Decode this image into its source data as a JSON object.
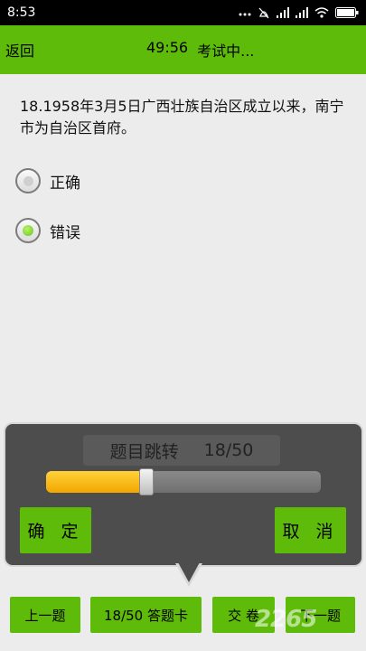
{
  "status_bar": {
    "time": "8:53",
    "icons": [
      "dots-icon",
      "alarm-off-icon",
      "signal-icon",
      "signal-icon",
      "wifi-icon",
      "battery-icon"
    ]
  },
  "header": {
    "back_label": "返回",
    "timer": "49:56",
    "status": "考试中..."
  },
  "question": {
    "text": "18.1958年3月5日广西壮族自治区成立以来，南宁市为自治区首府。"
  },
  "options": [
    {
      "label": "正确",
      "selected": false
    },
    {
      "label": "错误",
      "selected": true
    }
  ],
  "jump_dialog": {
    "title": "题目跳转",
    "progress": "18/50",
    "slider_value": 18,
    "slider_max": 50,
    "confirm_label": "确 定",
    "cancel_label": "取 消"
  },
  "bottom_bar": {
    "prev_label": "上一题",
    "card_label": "18/50 答题卡",
    "submit_label": "交 卷",
    "next_label": "下一题"
  },
  "watermark": "2265",
  "colors": {
    "accent": "#5fbb09",
    "dialog_bg": "#4d4d4d",
    "slider_fill": "#f2a600"
  }
}
